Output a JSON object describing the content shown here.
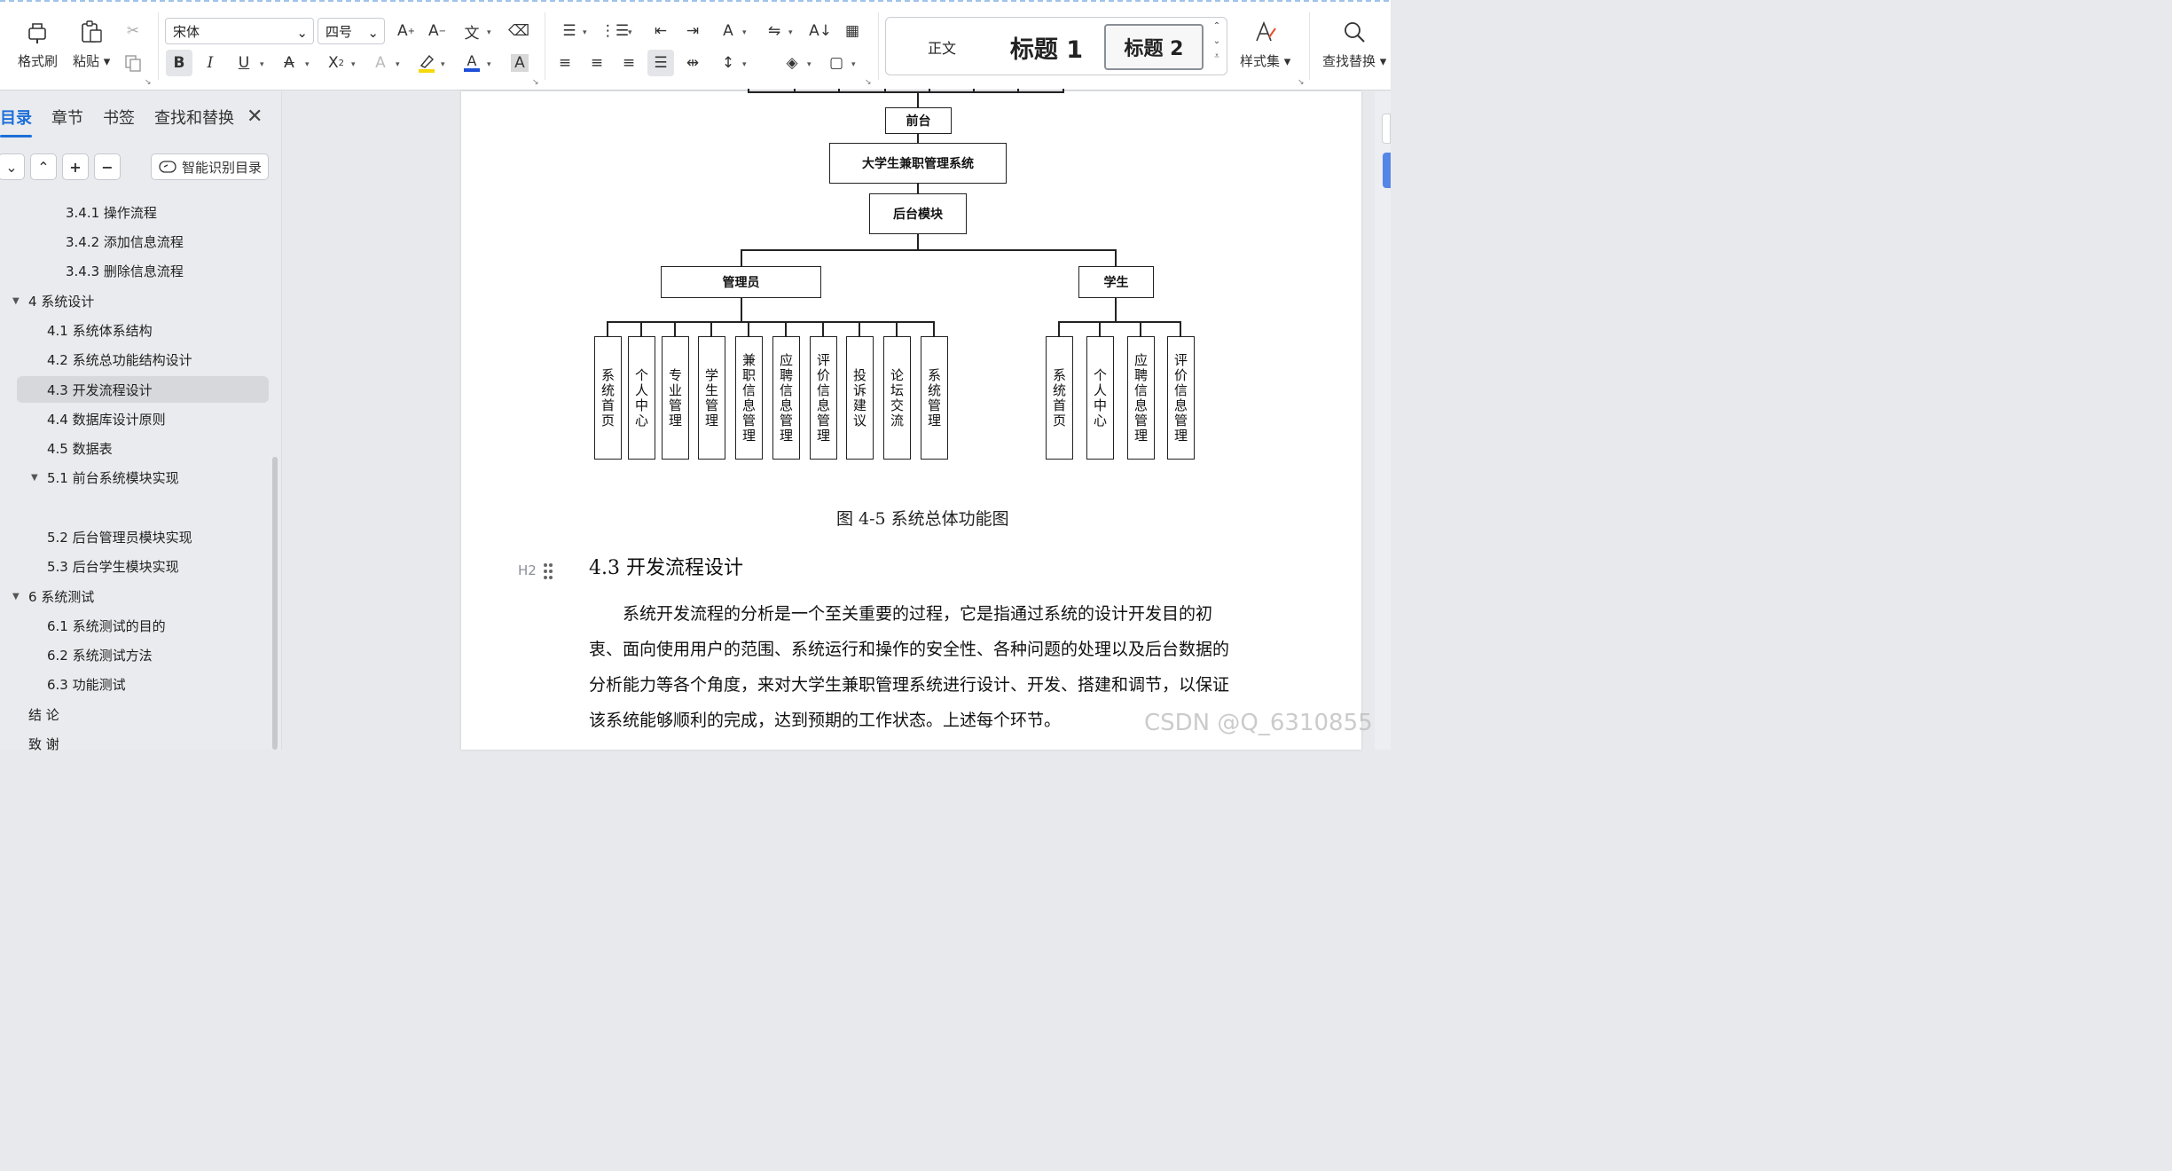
{
  "ribbon": {
    "format_painter": "格式刷",
    "paste": "粘贴",
    "font_name": "宋体",
    "font_size": "四号",
    "styles": {
      "normal": "正文",
      "heading1": "标题 1",
      "heading2": "标题 2"
    },
    "style_set": "样式集",
    "find_replace": "查找替换"
  },
  "nav": {
    "tabs": [
      "目录",
      "章节",
      "书签",
      "查找和替换"
    ],
    "smart_toc": "智能识别目录",
    "toc": [
      {
        "label": "3.4.1 操作流程",
        "level": 3
      },
      {
        "label": "3.4.2 添加信息流程",
        "level": 3
      },
      {
        "label": "3.4.3 删除信息流程",
        "level": 3
      },
      {
        "label": "4  系统设计",
        "level": 1,
        "expanded": true
      },
      {
        "label": "4.1  系统体系结构",
        "level": 2
      },
      {
        "label": "4.2  系统总功能结构设计",
        "level": 2
      },
      {
        "label": "4.3 开发流程设计",
        "level": 2,
        "selected": true
      },
      {
        "label": "4.4  数据库设计原则",
        "level": 2
      },
      {
        "label": "4.5  数据表",
        "level": 2
      },
      {
        "label": "5.1 前台系统模块实现",
        "level": 2,
        "expanded": true
      },
      {
        "label": "5.2 后台管理员模块实现",
        "level": 2
      },
      {
        "label": "5.3 后台学生模块实现",
        "level": 2
      },
      {
        "label": "6    系统测试",
        "level": 1,
        "expanded": true
      },
      {
        "label": "6.1 系统测试的目的",
        "level": 2
      },
      {
        "label": "6.2 系统测试方法",
        "level": 2
      },
      {
        "label": "6.3 功能测试",
        "level": 2
      },
      {
        "label": "结  论",
        "level": 1
      },
      {
        "label": "致  谢",
        "level": 1
      }
    ]
  },
  "diagram": {
    "front": "前台",
    "system": "大学生兼职管理系统",
    "backend": "后台模块",
    "admin": "管理员",
    "student": "学生",
    "admin_modules": [
      "系统首页",
      "个人中心",
      "专业管理",
      "学生管理",
      "兼职信息管理",
      "应聘信息管理",
      "评价信息管理",
      "投诉建议",
      "论坛交流",
      "系统管理"
    ],
    "student_modules": [
      "系统首页",
      "个人中心",
      "应聘信息管理",
      "评价信息管理"
    ]
  },
  "document": {
    "caption": "图 4-5  系统总体功能图",
    "heading_marker": "H2",
    "heading": "4.3 开发流程设计",
    "paragraph": "系统开发流程的分析是一个至关重要的过程，它是指通过系统的设计开发目的初衷、面向使用用户的范围、系统运行和操作的安全性、各种问题的处理以及后台数据的分析能力等各个角度，来对大学生兼职管理系统进行设计、开发、搭建和调节，以保证该系统能够顺利的完成，达到预期的工作状态。上述每个环节。",
    "watermark": "CSDN @Q_6310855"
  }
}
